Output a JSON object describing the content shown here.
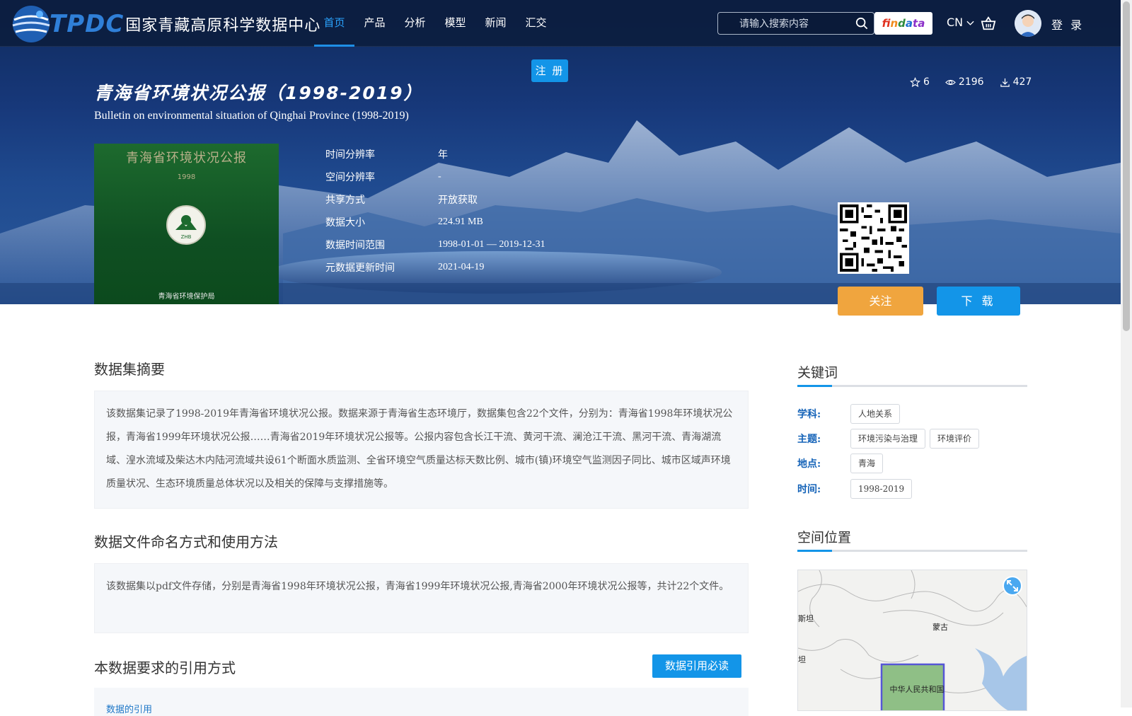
{
  "header": {
    "logo_abbr": "TPDC",
    "logo_name": "国家青藏高原科学数据中心",
    "nav": [
      {
        "label": "首页",
        "active": true
      },
      {
        "label": "产品"
      },
      {
        "label": "分析"
      },
      {
        "label": "模型"
      },
      {
        "label": "新闻"
      },
      {
        "label": "汇交"
      }
    ],
    "search_placeholder": "请输入搜索内容",
    "findata_label": "findata",
    "lang": "CN",
    "login": "登 录",
    "register": "注 册"
  },
  "dataset": {
    "title_cn": "青海省环境状况公报（1998-2019）",
    "title_en": "Bulletin on environmental situation of Qinghai Province (1998-2019)",
    "stats": {
      "stars": "6",
      "views": "2196",
      "downloads": "427"
    },
    "cover": {
      "title": "青海省环境状况公报",
      "year": "1998",
      "emblem_text": "ZHB",
      "publisher": "青海省环境保护局"
    },
    "meta": [
      {
        "key": "时间分辨率",
        "value": "年"
      },
      {
        "key": "空间分辨率",
        "value": "-"
      },
      {
        "key": "共享方式",
        "value": "开放获取"
      },
      {
        "key": "数据大小",
        "value": "224.91 MB"
      },
      {
        "key": "数据时间范围",
        "value": "1998-01-01 — 2019-12-31"
      },
      {
        "key": "元数据更新时间",
        "value": "2021-04-19"
      }
    ],
    "follow_label": "关注",
    "download_label": "下 载"
  },
  "main": {
    "abstract_title": "数据集摘要",
    "abstract_text": "该数据集记录了1998-2019年青海省环境状况公报。数据来源于青海省生态环境厅，数据集包含22个文件，分别为：青海省1998年环境状况公报，青海省1999年环境状况公报……青海省2019年环境状况公报等。公报内容包含长江干流、黄河干流、澜沧江干流、黑河干流、青海湖流域、湟水流域及柴达木内陆河流域共设61个断面水质监测、全省环境空气质量达标天数比例、城市(镇)环境空气监测因子同比、城市区域声环境质量状况、生态环境质量总体状况以及相关的保障与支撑措施等。",
    "files_title": "数据文件命名方式和使用方法",
    "files_text": "该数据集以pdf文件存储，分别是青海省1998年环境状况公报，青海省1999年环境状况公报,青海省2000年环境状况公报等，共计22个文件。",
    "citation_title": "本数据要求的引用方式",
    "citation_button": "数据引用必读",
    "citation_link": "数据的引用"
  },
  "sidebar": {
    "keywords_title": "关键词",
    "keywords": [
      {
        "label": "学科:",
        "tags": [
          "人地关系"
        ]
      },
      {
        "label": "主题:",
        "tags": [
          "环境污染与治理",
          "环境评价"
        ]
      },
      {
        "label": "地点:",
        "tags": [
          "青海"
        ]
      },
      {
        "label": "时间:",
        "tags": [
          "1998-2019"
        ]
      }
    ],
    "location_title": "空间位置",
    "map_labels": {
      "kazakh": "斯坦",
      "mongolia": "蒙古",
      "kyrgyz": "坦",
      "china": "中华人民共和国"
    }
  },
  "colors": {
    "accent": "#1395e8",
    "follow": "#f0a53e",
    "keyword_label": "#1563b8"
  }
}
